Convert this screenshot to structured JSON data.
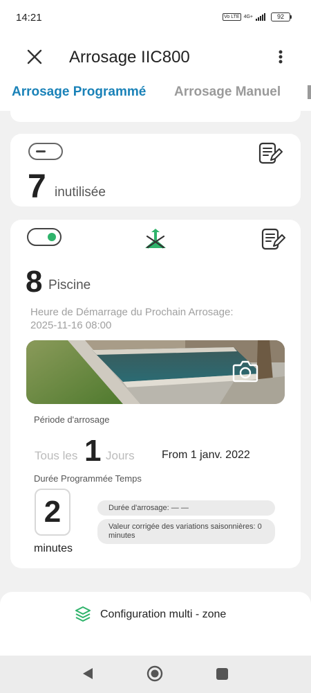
{
  "status_bar": {
    "time": "14:21",
    "volte": "Vo LTE",
    "network": "4G+",
    "battery": "92"
  },
  "app_bar": {
    "title": "Arrosage IIC800"
  },
  "tabs": [
    {
      "label": "Arrosage Programmé",
      "active": true
    },
    {
      "label": "Arrosage Manuel",
      "active": false
    }
  ],
  "zones": [
    {
      "number": "7",
      "name": "inutilisée",
      "enabled": false
    },
    {
      "number": "8",
      "name": "Piscine",
      "enabled": true,
      "next_start_label": "Heure de Démarrage du Prochain Arrosage:",
      "next_start_value": "2025-11-16 08:00",
      "period_label": "Période d'arrosage",
      "period_prefix": "Tous les",
      "period_value": "1",
      "period_unit": "Jours",
      "period_from": "From 1 janv. 2022",
      "duration_label": "Durée Programmée Temps",
      "duration_value": "2",
      "duration_unit": "minutes",
      "watering_duration": "Durée d'arrosage: — —",
      "seasonal_adjust": "Valeur corrigée des variations saisonnières: 0 minutes"
    }
  ],
  "multi_zone": {
    "label": "Configuration multi - zone"
  },
  "colors": {
    "accent": "#1a82b8",
    "active_green": "#2fb36b",
    "inactive_tab": "#9a9a9a"
  },
  "icons": {
    "close": "close-icon",
    "more": "more-vert-icon",
    "edit": "edit-note-icon",
    "sprinkler": "sprinkler-icon",
    "camera": "camera-icon",
    "layers": "layers-icon"
  }
}
